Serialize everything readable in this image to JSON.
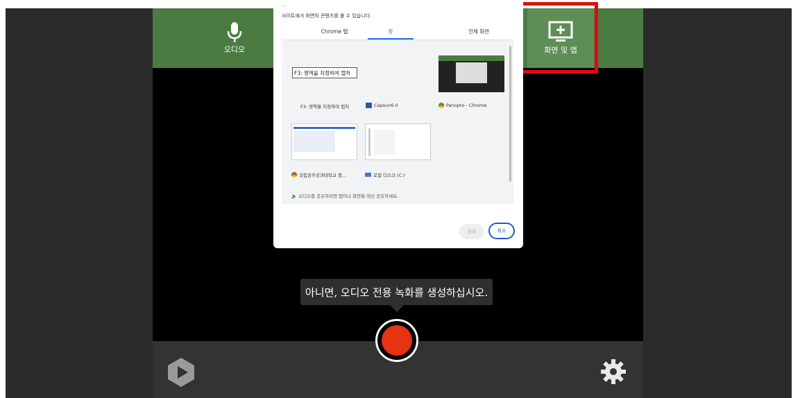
{
  "topbar": {
    "audio_label": "오디오",
    "screen_label": "화면 및 앱"
  },
  "dialog": {
    "top_text": "...",
    "desc": "사이트에서 화면의 콘텐츠를 볼 수 있습니다.",
    "tabs": [
      {
        "label": "Chrome 탭"
      },
      {
        "label": "창"
      },
      {
        "label": "전체 화면"
      }
    ],
    "items": [
      {
        "label": "F3: 영역을 지정하여 캡처",
        "thumb_text": "F3: 영역을 지정하여 캡처"
      },
      {
        "label": "Capsun6.0"
      },
      {
        "label": "Panopto - Chrome"
      },
      {
        "label": "국립공주공과대학교 컴..."
      },
      {
        "label": "로컬 디스크 (C:)"
      }
    ],
    "audio_note": "오디오를 공유하려면 탭이나 화면을 대신 공유하세요.",
    "share_label": "공유",
    "cancel_label": "취소"
  },
  "tooltip": "아니면, 오디오 전용 녹화를 생성하십시오.",
  "colors": {
    "topbar": "#4a7c42",
    "highlight": "#e10b0b",
    "record": "#e63312"
  }
}
